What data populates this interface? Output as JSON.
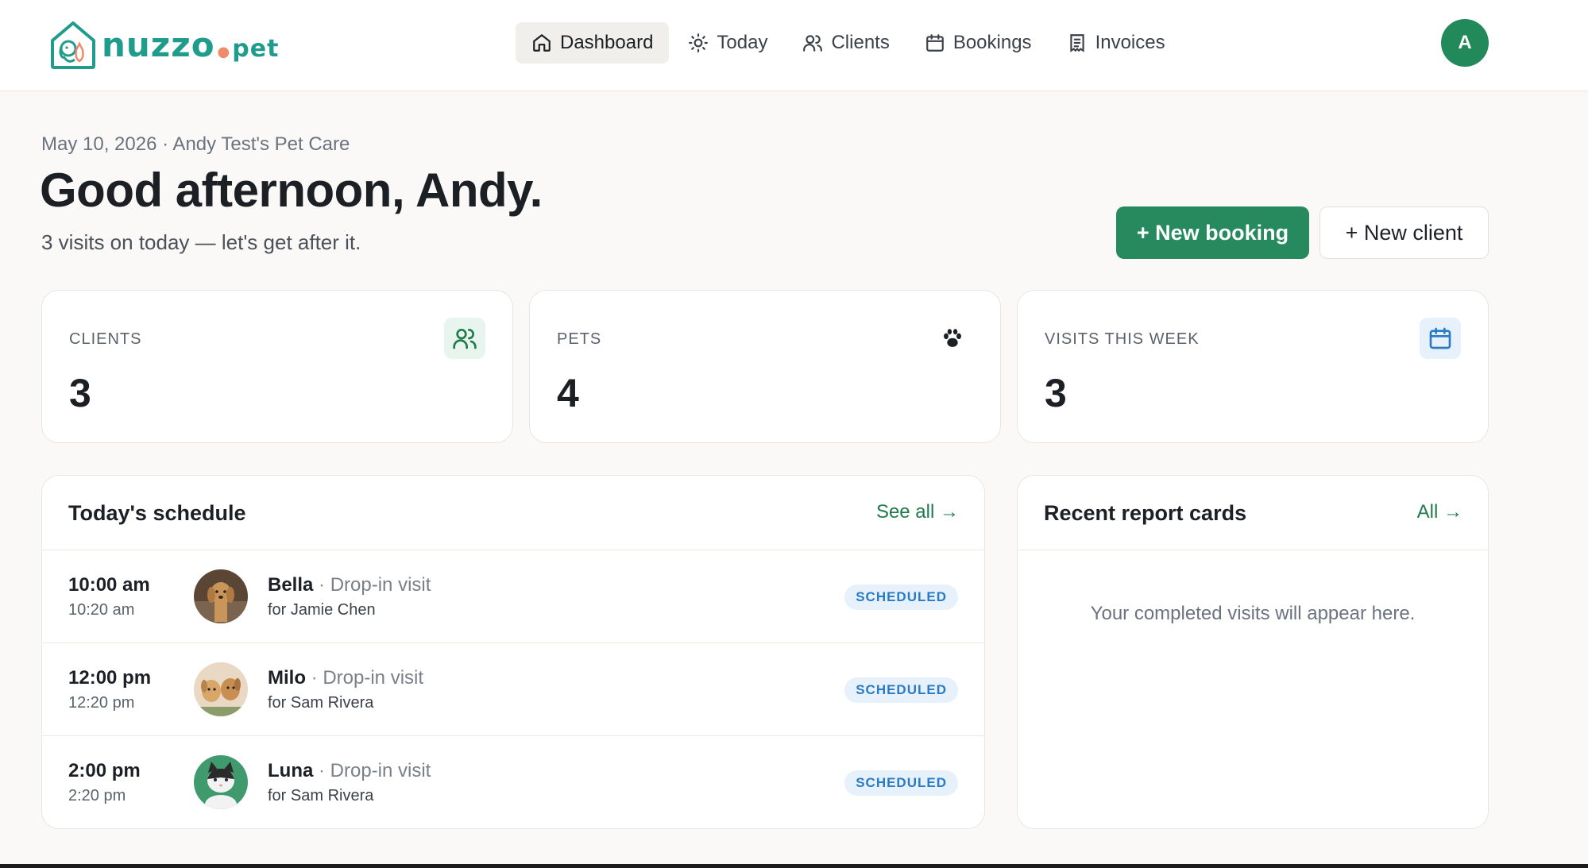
{
  "brand": {
    "name": "nuzzo",
    "suffix": "pet"
  },
  "nav": {
    "items": [
      {
        "label": "Dashboard",
        "icon": "home-icon",
        "active": true
      },
      {
        "label": "Today",
        "icon": "sun-icon",
        "active": false
      },
      {
        "label": "Clients",
        "icon": "users-icon",
        "active": false
      },
      {
        "label": "Bookings",
        "icon": "calendar-icon",
        "active": false
      },
      {
        "label": "Invoices",
        "icon": "receipt-icon",
        "active": false
      }
    ],
    "avatar_initial": "A"
  },
  "header": {
    "date_business": "May 10, 2026 · Andy Test's Pet Care",
    "greeting": "Good afternoon, Andy.",
    "subline": "3 visits on today — let's get after it.",
    "new_booking_label": "+ New booking",
    "new_client_label": "+ New client"
  },
  "stats": [
    {
      "label": "CLIENTS",
      "value": "3",
      "icon": "users-icon"
    },
    {
      "label": "PETS",
      "value": "4",
      "icon": "paw-icon"
    },
    {
      "label": "VISITS THIS WEEK",
      "value": "3",
      "icon": "calendar-icon"
    }
  ],
  "schedule": {
    "title": "Today's schedule",
    "link": "See all →",
    "rows": [
      {
        "start": "10:00 am",
        "end": "10:20 am",
        "pet": "Bella",
        "sep": " · ",
        "service": "Drop-in visit",
        "owner": "for Jamie Chen",
        "status": "SCHEDULED"
      },
      {
        "start": "12:00 pm",
        "end": "12:20 pm",
        "pet": "Milo",
        "sep": " · ",
        "service": "Drop-in visit",
        "owner": "for Sam Rivera",
        "status": "SCHEDULED"
      },
      {
        "start": "2:00 pm",
        "end": "2:20 pm",
        "pet": "Luna",
        "sep": " · ",
        "service": "Drop-in visit",
        "owner": "for Sam Rivera",
        "status": "SCHEDULED"
      }
    ]
  },
  "report_cards": {
    "title": "Recent report cards",
    "link": "All →",
    "empty": "Your completed visits will appear here."
  },
  "colors": {
    "brand_teal": "#1f9c8c",
    "primary_green": "#268a5e",
    "link_green": "#1f7a4d",
    "badge_blue": "#2a7bc4",
    "badge_bg": "#e6f1fb"
  }
}
